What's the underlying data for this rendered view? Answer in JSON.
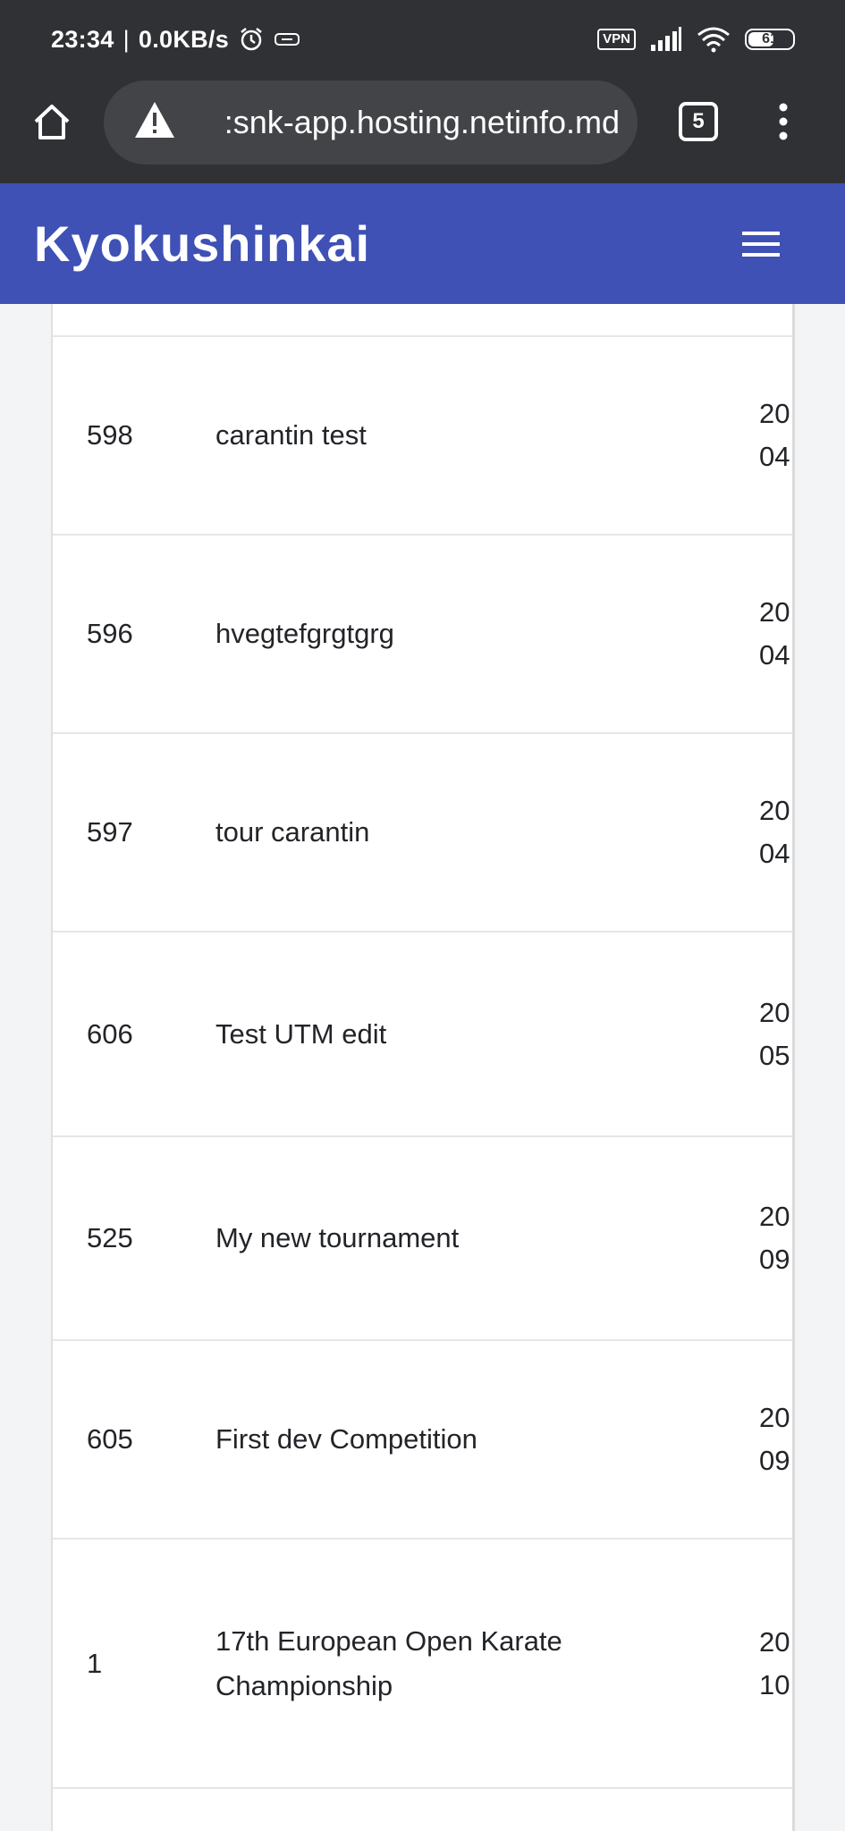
{
  "status_bar": {
    "time": "23:34",
    "separator": "|",
    "speed": "0.0KB/s",
    "vpn": "VPN",
    "battery": "61",
    "battery_level": 0.61,
    "icons": [
      "alarm-icon",
      "data-saver-icon",
      "signal-icon",
      "wifi-icon",
      "battery-icon"
    ]
  },
  "browser": {
    "url": ":snk-app.hosting.netinfo.md",
    "tab_count": "5",
    "icons": [
      "home-icon",
      "warning-icon",
      "tabs-icon",
      "more-vert-icon"
    ]
  },
  "navbar": {
    "brand": "Kyokushinkai",
    "accent_color": "#3f51b5",
    "icons": [
      "hamburger-menu-icon"
    ]
  },
  "table": {
    "rows": [
      {
        "id": "598",
        "name": "carantin test",
        "date_line1": "20",
        "date_line2": "04"
      },
      {
        "id": "596",
        "name": "hvegtefgrgtgrg",
        "date_line1": "20",
        "date_line2": "04"
      },
      {
        "id": "597",
        "name": "tour carantin",
        "date_line1": "20",
        "date_line2": "04"
      },
      {
        "id": "606",
        "name": "Test UTM edit",
        "date_line1": "20",
        "date_line2": "05"
      },
      {
        "id": "525",
        "name": "My new tournament",
        "date_line1": "20",
        "date_line2": "09"
      },
      {
        "id": "605",
        "name": "First dev Competition",
        "date_line1": "20",
        "date_line2": "09"
      },
      {
        "id": "1",
        "name": "17th European Open Karate Championship",
        "date_line1": "20",
        "date_line2": "10"
      }
    ]
  }
}
